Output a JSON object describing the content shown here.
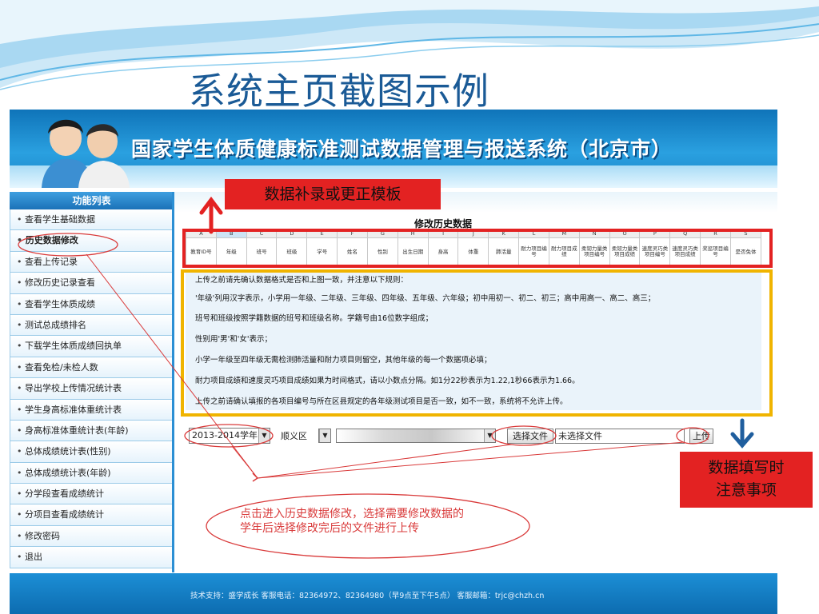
{
  "slide_title": "系统主页截图示例",
  "app": {
    "title": "国家学生体质健康标准测试数据管理与报送系统（北京市）"
  },
  "sidebar": {
    "heading": "功能列表",
    "items": [
      {
        "label": "查看学生基础数据"
      },
      {
        "label": "历史数据修改"
      },
      {
        "label": "查看上传记录"
      },
      {
        "label": "修改历史记录查看"
      },
      {
        "label": "查看学生体质成绩"
      },
      {
        "label": "测试总成绩排名"
      },
      {
        "label": "下载学生体质成绩回执单"
      },
      {
        "label": "查看免检/未检人数"
      },
      {
        "label": "导出学校上传情况统计表"
      },
      {
        "label": "学生身高标准体重统计表"
      },
      {
        "label": "身高标准体重统计表(年龄)"
      },
      {
        "label": "总体成绩统计表(性别)"
      },
      {
        "label": "总体成绩统计表(年龄)"
      },
      {
        "label": "分学段查看成绩统计"
      },
      {
        "label": "分项目查看成绩统计"
      },
      {
        "label": "修改密码"
      },
      {
        "label": "退出"
      }
    ]
  },
  "content": {
    "heading": "修改历史数据",
    "column_letters": [
      "A",
      "B",
      "C",
      "D",
      "E",
      "F",
      "G",
      "H",
      "I",
      "J",
      "K",
      "L",
      "M",
      "N",
      "O",
      "P",
      "Q",
      "R",
      "S"
    ],
    "column_headers": [
      "教育ID号",
      "年级",
      "班号",
      "班级",
      "学号",
      "姓名",
      "性别",
      "出生日期",
      "身高",
      "体重",
      "肺活量",
      "耐力项目编号",
      "耐力项目成绩",
      "柔韧力量类项目编号",
      "柔韧力量类项目成绩",
      "速度灵巧类项目编号",
      "速度灵巧类项目成绩",
      "奖惩项目编号",
      "是否免体"
    ],
    "notes": [
      "上传之前请先确认数据格式是否和上图一致，并注意以下规则：",
      "'年级'列用汉字表示，小学用一年级、二年级、三年级、四年级、五年级、六年级；初中用初一、初二、初三；高中用高一、高二、高三；",
      "班号和班级按照学籍数据的班号和班级名称。学籍号由16位数字组成；",
      "性别用'男'和'女'表示；",
      "小学一年级至四年级无需检测肺活量和耐力项目则留空，其他年级的每一个数据项必填；",
      "耐力项目成绩和速度灵巧项目成绩如果为时间格式，请以小数点分隔。如1分22秒表示为1.22,1秒66表示为1.66。",
      "上传之前请确认填报的各项目编号与所在区县规定的各年级测试项目是否一致，如不一致，系统将不允许上传。"
    ],
    "year_select": "2013-2014学年",
    "district_label": "顺义区",
    "file_button": "选择文件",
    "file_status": "未选择文件",
    "upload_button": "上传"
  },
  "footer": {
    "text": "技术支持：盛学成长    客服电话：82364972、82364980（早9点至下午5点）  客服邮箱：trjc@chzh.cn"
  },
  "annotations": {
    "template_label": "数据补录或更正模板",
    "notice_label_line1": "数据填写时",
    "notice_label_line2": "注意事项",
    "instruction_line1": "点击进入历史数据修改，选择需要修改数据的",
    "instruction_line2": "学年后选择修改完后的文件进行上传"
  },
  "colors": {
    "title_blue": "#1a5a96",
    "annotation_red": "#e32222",
    "annotation_yellow": "#f0b400",
    "arrow_blue": "#1f5e9e"
  }
}
